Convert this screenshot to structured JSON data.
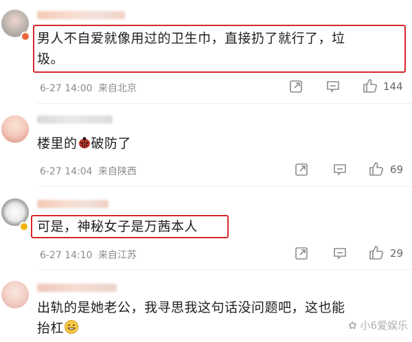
{
  "comments": [
    {
      "text_line1": "男人不自爱就像用过的卫生巾，直接扔了就行了，垃",
      "text_line2": "圾。",
      "time": "6-27 14:00",
      "location": "来自北京",
      "likes": "144"
    },
    {
      "text_prefix": "楼里的",
      "text_suffix": "破防了",
      "time": "6-27 14:04",
      "location": "来自陕西",
      "likes": "69"
    },
    {
      "text": "可是，神秘女子是万茜本人",
      "time": "6-27 14:10",
      "location": "来自江苏",
      "likes": "29"
    },
    {
      "text_line1": "出轨的是她老公，我寻思我这句话没问题吧，这也能",
      "text_line2": "抬杠"
    }
  ],
  "watermark": "小6爱娱乐",
  "icons": [
    "share-icon",
    "comment-icon",
    "like-icon",
    "ladybug-emoji",
    "grin-emoji"
  ],
  "colors": {
    "highlight_border": "#d8262b",
    "meta_text": "#8a8a8a",
    "divider": "#eeeeee"
  }
}
